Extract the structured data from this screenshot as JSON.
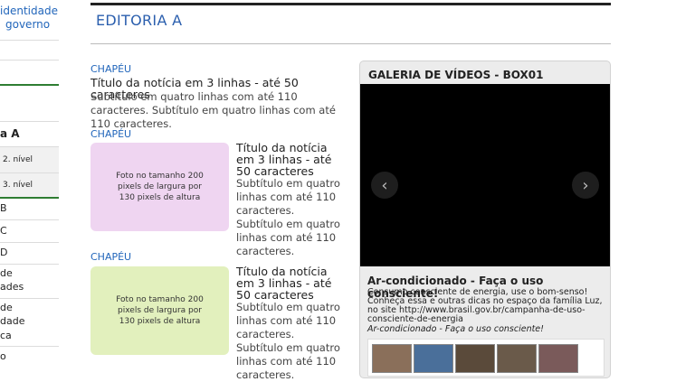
{
  "sidebar": {
    "top_link": [
      "identidade",
      "governo"
    ],
    "items": [
      {
        "label": "a A",
        "kind": "head"
      },
      {
        "label": "2. nível",
        "kind": "sub"
      },
      {
        "label": "3. nível",
        "kind": "sub"
      },
      {
        "label": "B",
        "kind": "item"
      },
      {
        "label": "C",
        "kind": "item"
      },
      {
        "label": "D",
        "kind": "item"
      },
      {
        "label": "de",
        "kind": "item"
      },
      {
        "label": "ades",
        "kind": "item"
      },
      {
        "label": "de",
        "kind": "item"
      },
      {
        "label": "dade",
        "kind": "item"
      },
      {
        "label": "ca",
        "kind": "item"
      },
      {
        "label": "o",
        "kind": "item"
      }
    ]
  },
  "section": {
    "title": "EDITORIA A"
  },
  "news": [
    {
      "chapeu": "CHAPÉU",
      "title": "Título da notícia em 3 linhas - até 50 caracteres",
      "subtitle": "Subtítulo em quatro linhas com até 110 caracteres. Subtítulo em quatro linhas com até 110 caracteres."
    },
    {
      "chapeu": "CHAPÉU",
      "photo_text": "Foto no tamanho 200 pixels de largura por 130 pixels de altura",
      "photo_color": "#efd5f1",
      "title": "Título da notícia em 3 linhas - até 50 caracteres",
      "subtitle": "Subtítulo em quatro linhas com até 110 caracteres. Subtítulo em quatro linhas com até 110 caracteres."
    },
    {
      "chapeu": "CHAPÉU",
      "photo_text": "Foto no tamanho 200 pixels de largura por 130 pixels de altura",
      "photo_color": "#e2f0bd",
      "title": "Título da notícia em 3 linhas - até 50 caracteres",
      "subtitle": "Subtítulo em quatro linhas com até 110 caracteres. Subtítulo em quatro linhas com até 110 caracteres."
    }
  ],
  "video_box": {
    "title": "GALERIA DE VÍDEOS - BOX01",
    "prev_icon": "‹",
    "next_icon": "›",
    "caption_title": "Ar-condicionado - Faça o uso consciente!",
    "caption_desc": "Consumo consciente de energia, use o bom-senso! Conheça essa e outras dicas no espaço da família Luz, no site http://www.brasil.gov.br/campanha-de-uso-consciente-de-energia",
    "caption_italic": "Ar-condicionado - Faça o uso consciente!",
    "thumb_colors": [
      "#8a6f5a",
      "#4a6f9a",
      "#5a4a3a",
      "#6a5a4a",
      "#7a5a5a"
    ]
  },
  "colors": {
    "accent": "#2b5fae",
    "link": "#2266bb",
    "sidebar_rule": "#2e7d32"
  }
}
